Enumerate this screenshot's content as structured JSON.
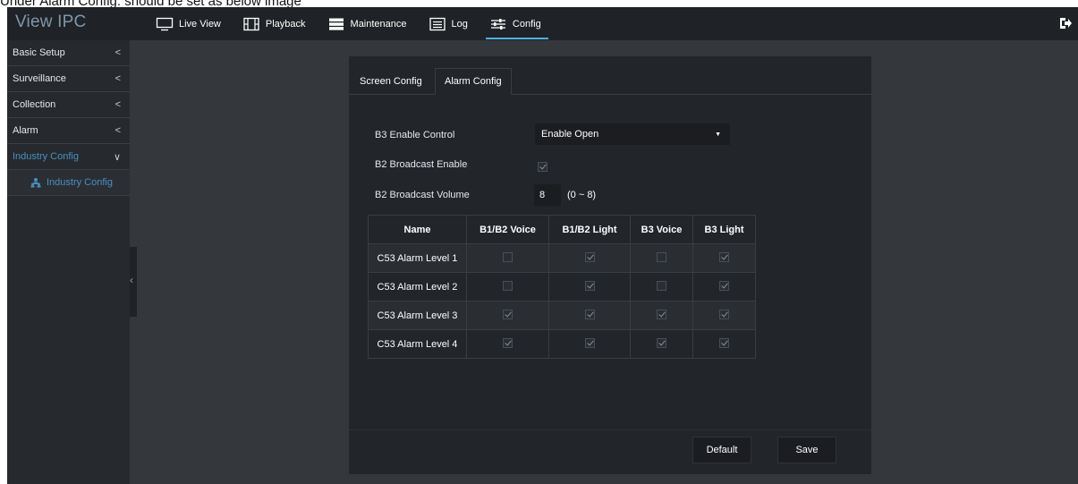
{
  "caption": "Under Alarm Config: should be set as below image",
  "app": {
    "title": "View IPC"
  },
  "nav": [
    {
      "label": "Live View",
      "icon": "monitor-icon"
    },
    {
      "label": "Playback",
      "icon": "film-icon"
    },
    {
      "label": "Maintenance",
      "icon": "server-icon"
    },
    {
      "label": "Log",
      "icon": "list-icon"
    },
    {
      "label": "Config",
      "icon": "sliders-icon",
      "active": true
    }
  ],
  "sidebar": {
    "items": [
      {
        "label": "Basic Setup",
        "chevron": "<"
      },
      {
        "label": "Surveillance",
        "chevron": "<"
      },
      {
        "label": "Collection",
        "chevron": "<"
      },
      {
        "label": "Alarm",
        "chevron": "<"
      },
      {
        "label": "Industry Config",
        "chevron": "∨"
      }
    ],
    "sub_item": {
      "label": "Industry Config",
      "icon": "users-icon"
    }
  },
  "tabs": [
    {
      "label": "Screen Config"
    },
    {
      "label": "Alarm Config",
      "active": true
    }
  ],
  "form": {
    "b3_enable_label": "B3 Enable Control",
    "b3_enable_value": "Enable Open",
    "b2_broadcast_enable_label": "B2 Broadcast Enable",
    "b2_broadcast_enable_checked": true,
    "b2_broadcast_volume_label": "B2 Broadcast Volume",
    "b2_broadcast_volume_value": "8",
    "b2_broadcast_volume_range": "(0 ~ 8)"
  },
  "table": {
    "headers": [
      "Name",
      "B1/B2 Voice",
      "B1/B2 Light",
      "B3 Voice",
      "B3 Light"
    ],
    "rows": [
      {
        "name": "C53 Alarm Level 1",
        "values": [
          false,
          true,
          false,
          true
        ]
      },
      {
        "name": "C53 Alarm Level 2",
        "values": [
          false,
          true,
          false,
          true
        ]
      },
      {
        "name": "C53 Alarm Level 3",
        "values": [
          true,
          true,
          true,
          true
        ]
      },
      {
        "name": "C53 Alarm Level 4",
        "values": [
          true,
          true,
          true,
          true
        ]
      }
    ]
  },
  "buttons": {
    "default_label": "Default",
    "save_label": "Save"
  },
  "colors": {
    "accent": "#4db2e0",
    "sidebar_active": "#4a8fc2",
    "panel_bg": "#22252a",
    "page_bg": "#34383d"
  }
}
